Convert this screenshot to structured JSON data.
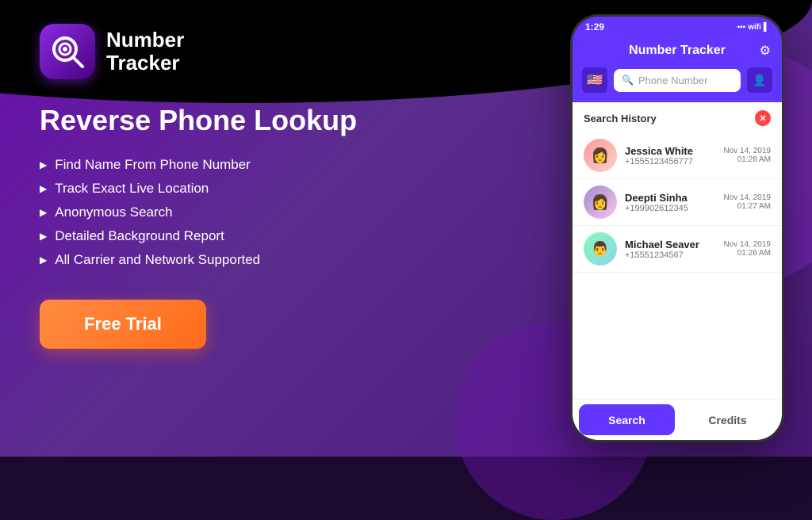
{
  "background": {
    "topColor": "#000000",
    "mainColor": "#5b2d8e"
  },
  "logo": {
    "name1": "Number",
    "name2": "Tracker"
  },
  "heading": "Reverse Phone Lookup",
  "features": [
    "Find Name From Phone Number",
    "Track Exact Live Location",
    "Anonymous Search",
    "Detailed Background Report",
    "All Carrier and Network Supported"
  ],
  "cta_button": "Free Trial",
  "phone": {
    "status_time": "1:29",
    "status_signal": "▪▪▪",
    "header_title": "Number Tracker",
    "settings_icon": "⚙",
    "flag_emoji": "🇺🇸",
    "search_placeholder": "Phone Number",
    "search_history_label": "Search History",
    "history_items": [
      {
        "name": "Jessica White",
        "phone": "+15551234567​77",
        "date": "Nov 14, 2019",
        "time": "01:28 AM",
        "avatar_emoji": "👩"
      },
      {
        "name": "Deepti Sinha",
        "phone": "+19990261​2345",
        "date": "Nov 14, 2019",
        "time": "01:27 AM",
        "avatar_emoji": "👩"
      },
      {
        "name": "Michael Seaver",
        "phone": "+15551234567",
        "date": "Nov 14, 2019",
        "time": "01:26 AM",
        "avatar_emoji": "👨"
      }
    ],
    "tab_search": "Search",
    "tab_credits": "Credits"
  }
}
